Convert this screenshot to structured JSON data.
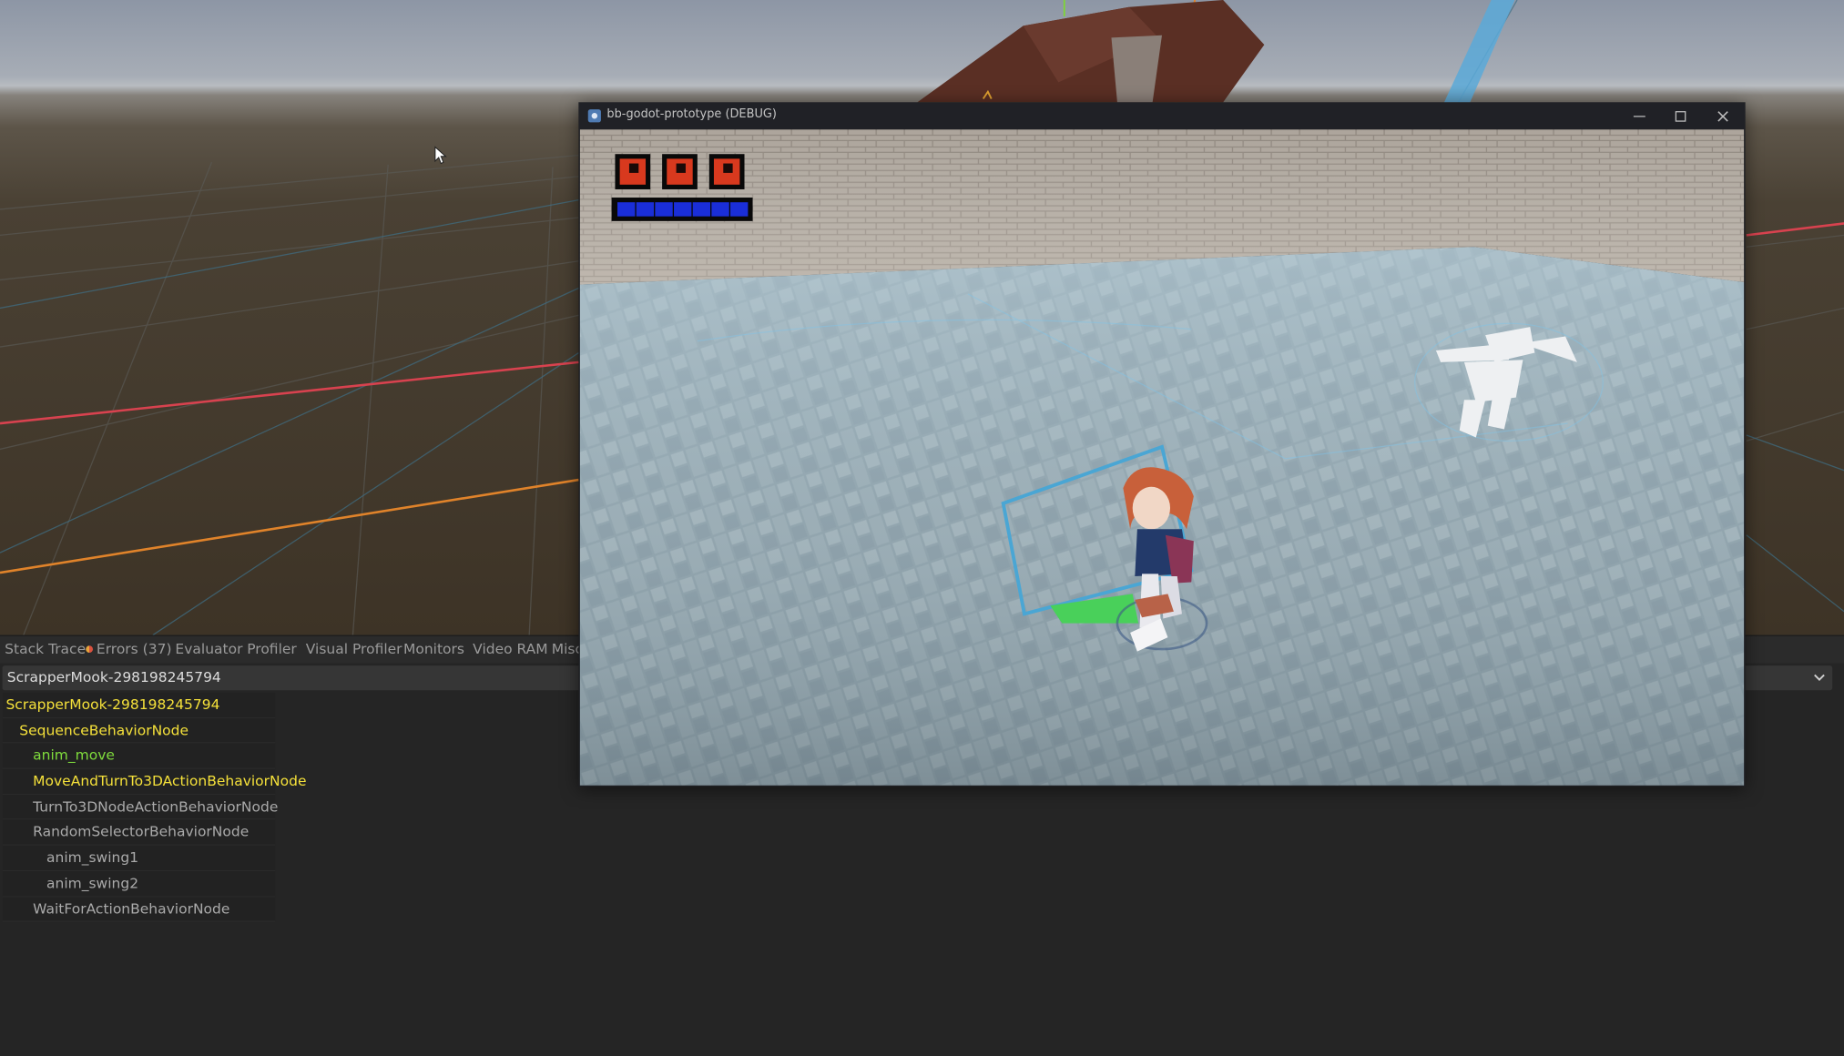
{
  "game_window": {
    "title": "bb-godot-prototype (DEBUG)",
    "hud": {
      "health": 3,
      "max_health": 3,
      "energy_fraction": 1.0
    }
  },
  "debugger": {
    "tabs": [
      {
        "label": "Stack Trace"
      },
      {
        "label": "Errors (37)"
      },
      {
        "label": "Evaluator"
      },
      {
        "label": "Profiler"
      },
      {
        "label": "Visual Profiler"
      },
      {
        "label": "Monitors"
      },
      {
        "label": "Video RAM"
      },
      {
        "label": "Misc"
      }
    ],
    "selected_tree": "ScrapperMook-298198245794",
    "tree": [
      {
        "label": "ScrapperMook-298198245794",
        "depth": 0,
        "state": "running"
      },
      {
        "label": "SequenceBehaviorNode",
        "depth": 1,
        "state": "running"
      },
      {
        "label": "anim_move",
        "depth": 2,
        "state": "success"
      },
      {
        "label": "MoveAndTurnTo3DActionBehaviorNode",
        "depth": 2,
        "state": "running"
      },
      {
        "label": "TurnTo3DNodeActionBehaviorNode",
        "depth": 2,
        "state": "idle"
      },
      {
        "label": "RandomSelectorBehaviorNode",
        "depth": 2,
        "state": "idle"
      },
      {
        "label": "anim_swing1",
        "depth": 3,
        "state": "idle"
      },
      {
        "label": "anim_swing2",
        "depth": 3,
        "state": "idle"
      },
      {
        "label": "WaitForActionBehaviorNode",
        "depth": 2,
        "state": "idle"
      }
    ]
  },
  "colors": {
    "running": "#f5e13a",
    "success": "#7fdc3c",
    "idle": "#aaaaaa"
  }
}
